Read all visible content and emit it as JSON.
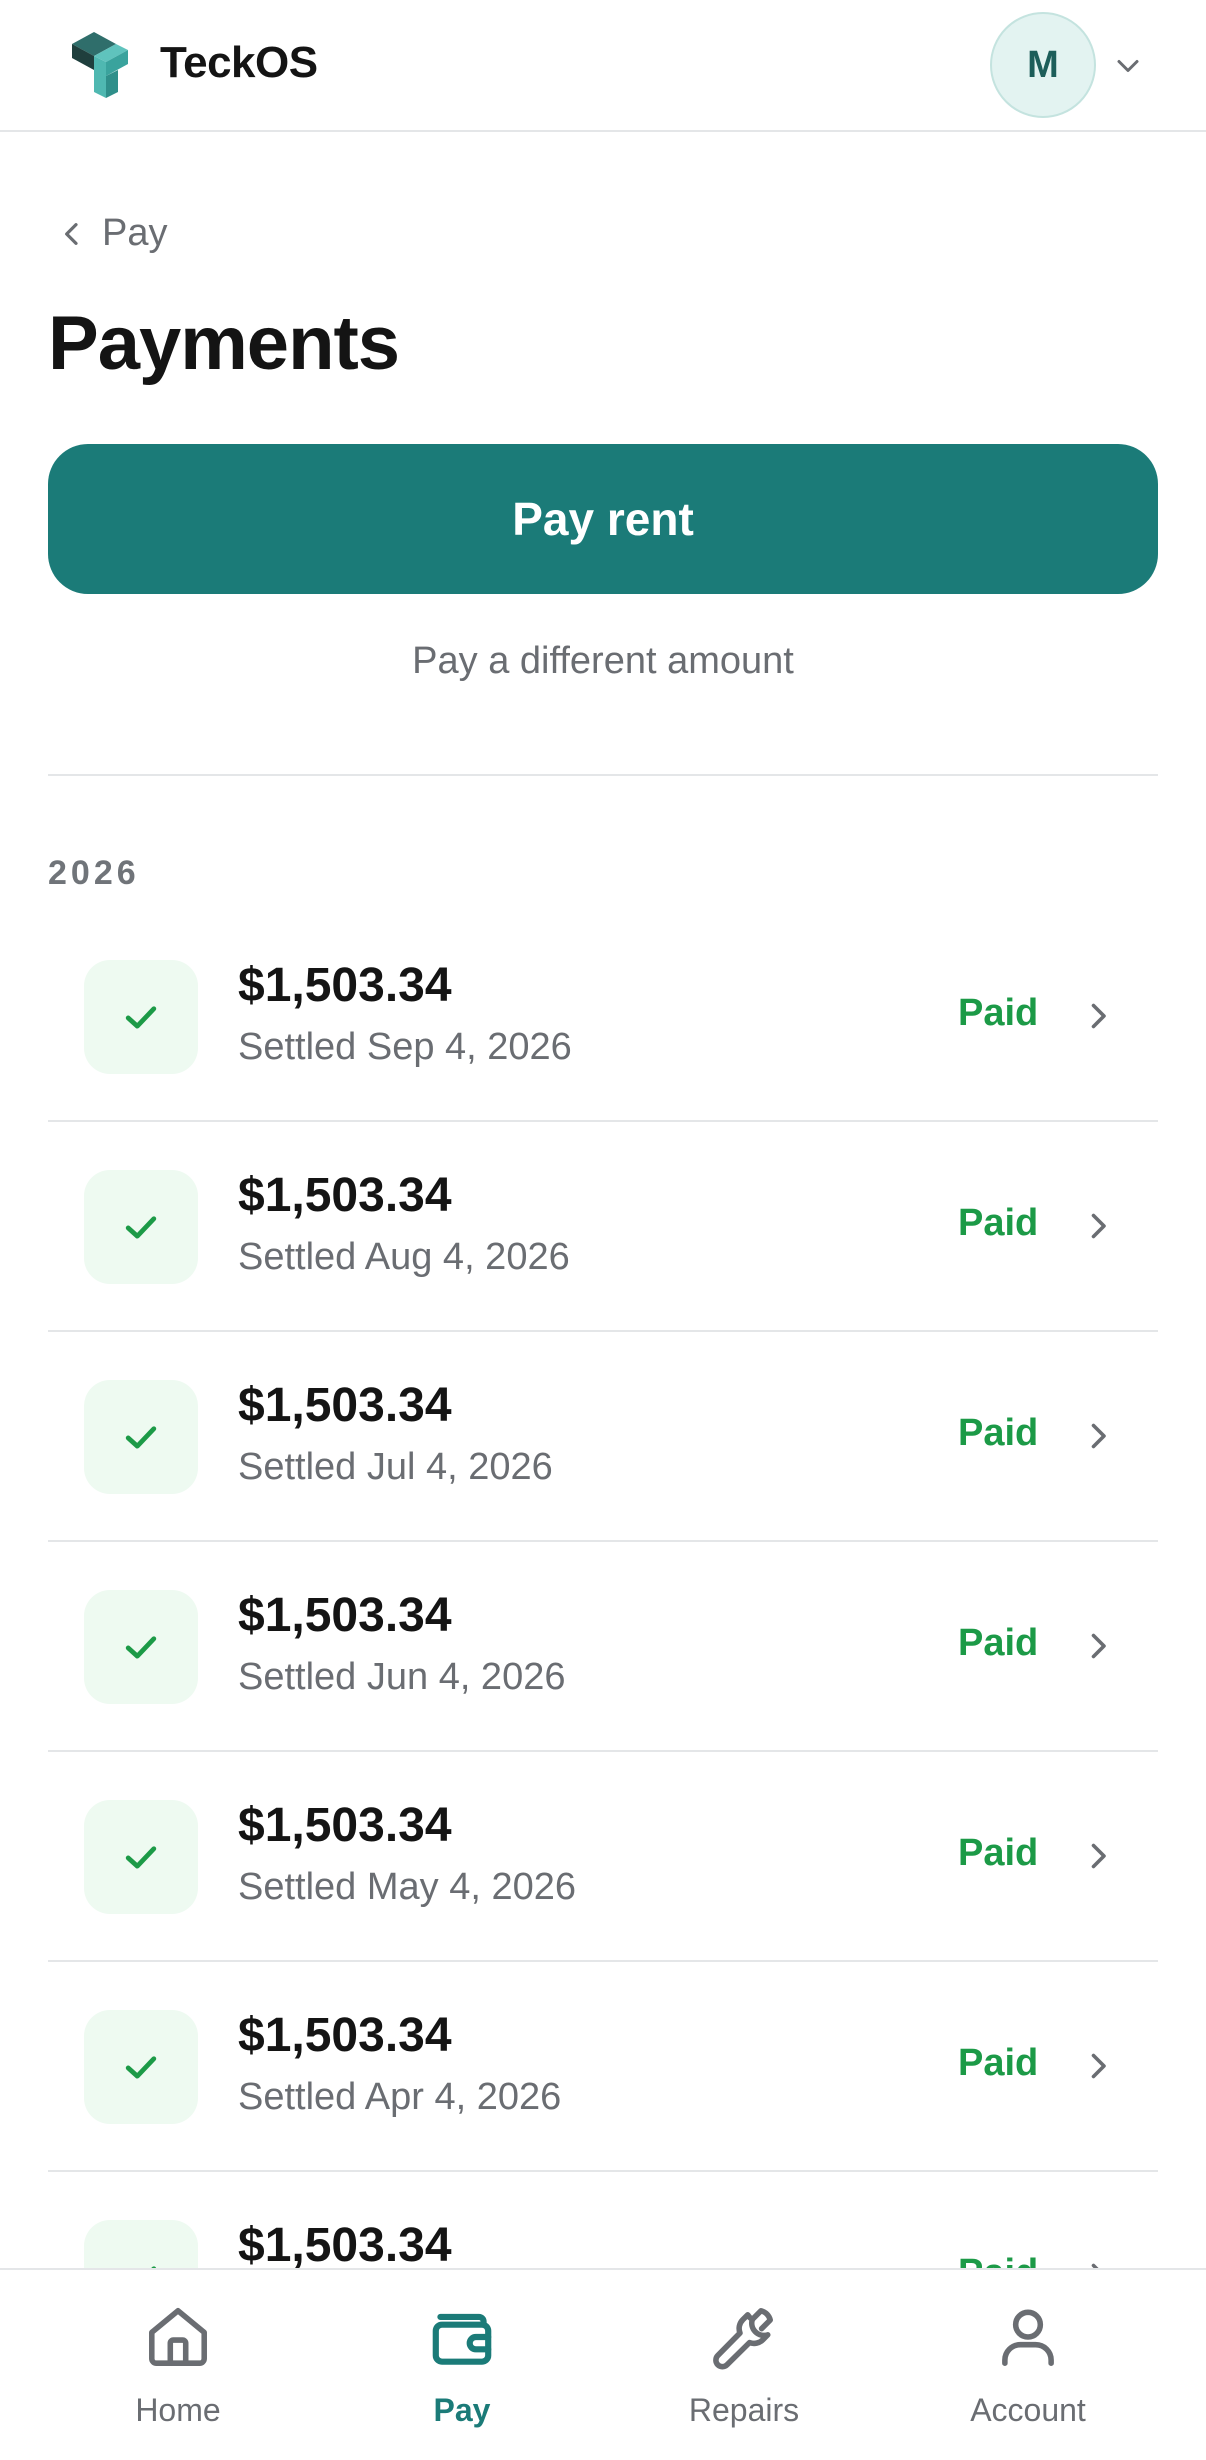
{
  "header": {
    "brand": "TeckOS",
    "avatar_initial": "M"
  },
  "nav": {
    "back_label": "Pay"
  },
  "page": {
    "title": "Payments",
    "pay_rent_label": "Pay rent",
    "pay_different_label": "Pay a different amount"
  },
  "payments": {
    "year": "2026",
    "items": [
      {
        "amount": "$1,503.34",
        "settled": "Settled Sep 4, 2026",
        "status": "Paid"
      },
      {
        "amount": "$1,503.34",
        "settled": "Settled Aug 4, 2026",
        "status": "Paid"
      },
      {
        "amount": "$1,503.34",
        "settled": "Settled Jul 4, 2026",
        "status": "Paid"
      },
      {
        "amount": "$1,503.34",
        "settled": "Settled Jun 4, 2026",
        "status": "Paid"
      },
      {
        "amount": "$1,503.34",
        "settled": "Settled May 4, 2026",
        "status": "Paid"
      },
      {
        "amount": "$1,503.34",
        "settled": "Settled Apr 4, 2026",
        "status": "Paid"
      },
      {
        "amount": "$1,503.34",
        "settled": "",
        "status": "Paid"
      }
    ]
  },
  "bottom_nav": {
    "items": [
      {
        "label": "Home",
        "icon": "home-icon"
      },
      {
        "label": "Pay",
        "icon": "wallet-icon",
        "active": true
      },
      {
        "label": "Repairs",
        "icon": "wrench-icon"
      },
      {
        "label": "Account",
        "icon": "person-icon"
      }
    ]
  },
  "colors": {
    "accent": "#1b7b78",
    "paid": "#1c9a47",
    "check_bg": "#eefaf1",
    "avatar_bg": "#e3f3f1"
  }
}
